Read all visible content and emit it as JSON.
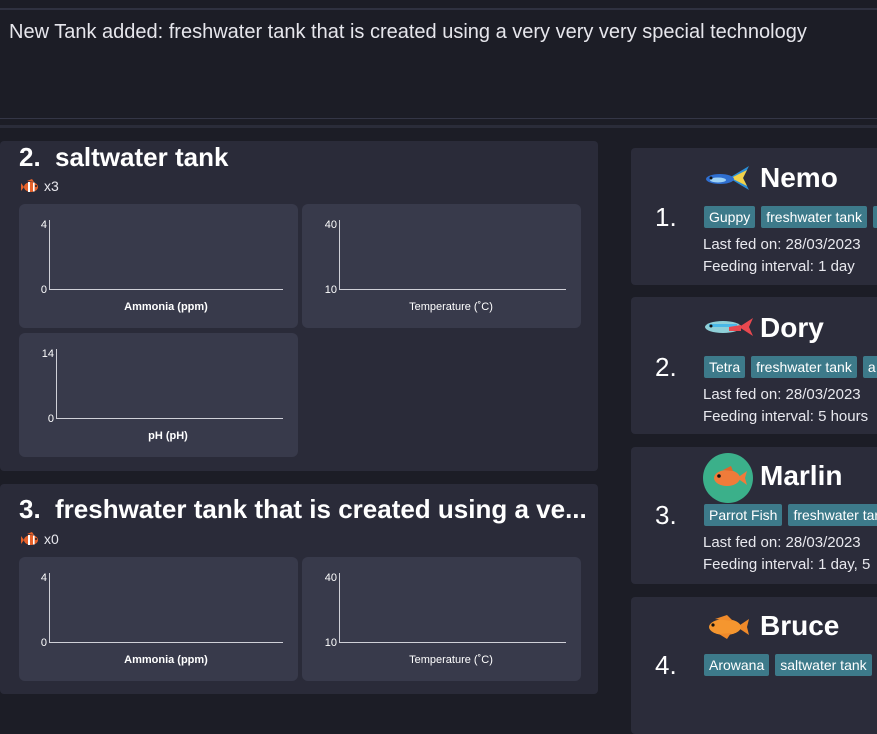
{
  "result": "New Tank added: freshwater tank that is created using a very very very special technology",
  "tanks": [
    {
      "index": "2.",
      "name": "saltwater tank",
      "fish_count": "x3",
      "graphs": [
        {
          "ymax": "4",
          "ymin": "0",
          "label": "Ammonia (ppm)"
        },
        {
          "ymax": "40",
          "ymin": "10",
          "label": "Temperature (˚C)"
        },
        {
          "ymax": "14",
          "ymin": "0",
          "label": "pH (pH)"
        }
      ]
    },
    {
      "index": "3.",
      "name": "freshwater tank that is created using a ve...",
      "fish_count": "x0",
      "graphs": [
        {
          "ymax": "4",
          "ymin": "0",
          "label": "Ammonia (ppm)"
        },
        {
          "ymax": "40",
          "ymin": "10",
          "label": "Temperature (˚C)"
        }
      ]
    }
  ],
  "fish": [
    {
      "index": "1.",
      "name": "Nemo",
      "icon": "guppy-icon",
      "tags": [
        "Guppy",
        "freshwater tank",
        ""
      ],
      "last_fed": "Last fed on: 28/03/2023",
      "interval": "Feeding interval: 1 day"
    },
    {
      "index": "2.",
      "name": "Dory",
      "icon": "tetra-icon",
      "tags": [
        "Tetra",
        "freshwater tank",
        "a"
      ],
      "last_fed": "Last fed on: 28/03/2023",
      "interval": "Feeding interval: 5 hours"
    },
    {
      "index": "3.",
      "name": "Marlin",
      "icon": "parrot-fish-icon",
      "tags": [
        "Parrot Fish",
        "freshwater tar"
      ],
      "last_fed": "Last fed on: 28/03/2023",
      "interval": "Feeding interval: 1 day, 5"
    },
    {
      "index": "4.",
      "name": "Bruce",
      "icon": "arowana-icon",
      "tags": [
        "Arowana",
        "saltwater tank"
      ]
    }
  ]
}
